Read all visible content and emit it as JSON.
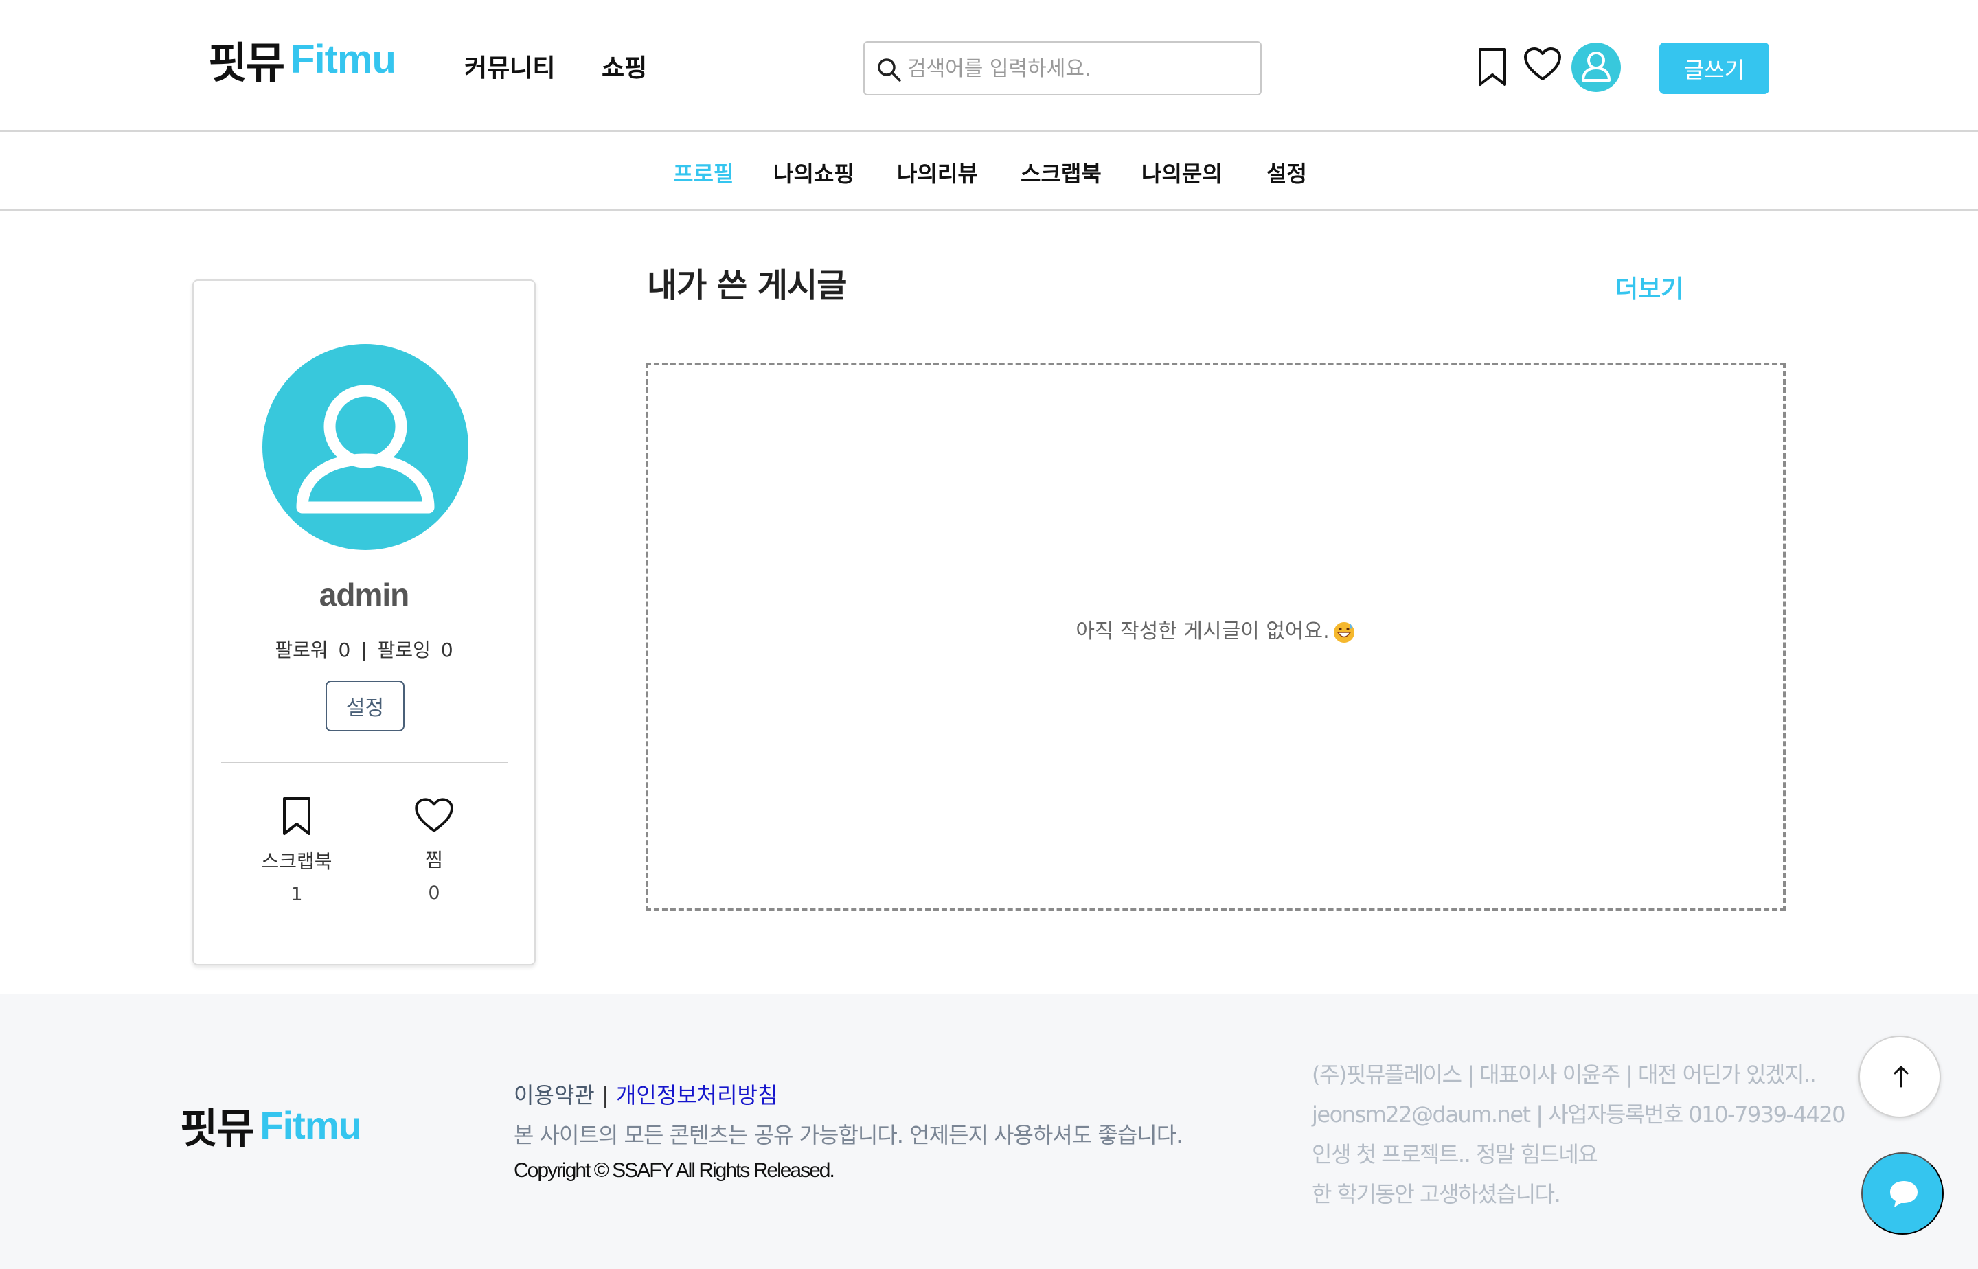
{
  "header": {
    "logo": {
      "korean": "핏뮤",
      "english": "Fitmu"
    },
    "nav": [
      {
        "label": "커뮤니티"
      },
      {
        "label": "쇼핑"
      }
    ],
    "search": {
      "placeholder": "검색어를 입력하세요.",
      "value": ""
    },
    "icons": [
      "bookmark-icon",
      "heart-icon",
      "user-avatar-icon"
    ],
    "write_button": "글쓰기"
  },
  "subnav": {
    "active": "프로필",
    "tabs": [
      {
        "label": "프로필"
      },
      {
        "label": "나의쇼핑"
      },
      {
        "label": "나의리뷰"
      },
      {
        "label": "스크랩북"
      },
      {
        "label": "나의문의"
      },
      {
        "label": "설정"
      }
    ]
  },
  "profile": {
    "username": "admin",
    "follower_label": "팔로워",
    "follower_count": "0",
    "separator": "|",
    "following_label": "팔로잉",
    "following_count": "0",
    "setting_button": "설정",
    "stats": [
      {
        "icon": "bookmark-icon",
        "label": "스크랩북",
        "value": "1"
      },
      {
        "icon": "heart-icon",
        "label": "찜",
        "value": "0"
      }
    ]
  },
  "posts": {
    "title": "내가 쓴 게시글",
    "more": "더보기",
    "empty_message": "아직 작성한 게시글이 없어요."
  },
  "footer": {
    "logo": {
      "korean": "핏뮤",
      "english": "Fitmu"
    },
    "terms": "이용약관",
    "links_separator": " | ",
    "privacy": "개인정보처리방침",
    "notice": "본 사이트의 모든 콘텐츠는 공유 가능합니다. 언제든지 사용하셔도 좋습니다.",
    "copyright": "Copyright © SSAFY All Rights Released.",
    "company_info": [
      "(주)핏뮤플레이스 | 대표이사 이윤주 | 대전 어딘가 있겠지..",
      "jeonsm22@daum.net | 사업자등록번호 010-7939-4420",
      "인생 첫 프로젝트.. 정말 힘드네요",
      "한 학기동안 고생하셨습니다."
    ]
  },
  "floating": [
    "arrow-up-icon",
    "chat-bubble-icon"
  ],
  "colors": {
    "brand": "#35c5ef",
    "avatar": "#38c8dc",
    "privacy_link": "#1515cc"
  }
}
